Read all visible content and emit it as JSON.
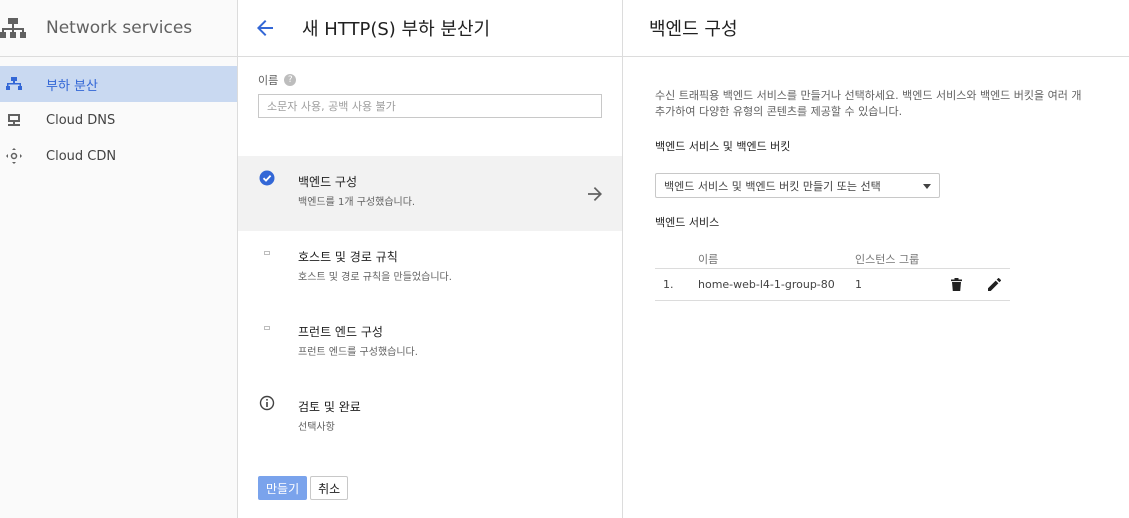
{
  "nav": {
    "title": "Network services",
    "items": [
      {
        "label": "부하 분산",
        "icon": "load-balancing-icon",
        "active": true
      },
      {
        "label": "Cloud DNS",
        "icon": "dns-icon",
        "active": false
      },
      {
        "label": "Cloud CDN",
        "icon": "cdn-icon",
        "active": false
      }
    ]
  },
  "middle": {
    "title": "새 HTTP(S) 부하 분산기",
    "name_label": "이름",
    "name_placeholder": "소문자 사용, 공백 사용 불가",
    "steps": [
      {
        "title": "백엔드 구성",
        "subtitle": "백엔드를 1개 구성했습니다.",
        "icon": "check-circle-icon",
        "active": true
      },
      {
        "title": "호스트 및 경로 규칙",
        "subtitle": "호스트 및 경로 규칙을 만들었습니다.",
        "icon": "pending-dot-icon",
        "active": false
      },
      {
        "title": "프런트 엔드 구성",
        "subtitle": "프런트 엔드를 구성했습니다.",
        "icon": "pending-dot-icon",
        "active": false
      },
      {
        "title": "검토 및 완료",
        "subtitle": "선택사항",
        "icon": "info-icon",
        "active": false
      }
    ],
    "create_label": "만들기",
    "cancel_label": "취소"
  },
  "right": {
    "title": "백엔드 구성",
    "description": "수신 트래픽용 백엔드 서비스를 만들거나 선택하세요. 백엔드 서비스와 백엔드 버킷을 여러 개 추가하여 다양한 유형의 콘텐츠를 제공할 수 있습니다.",
    "services_buckets_label": "백엔드 서비스 및 백엔드 버킷",
    "select_value": "백엔드 서비스 및 백엔드 버킷 만들기 또는 선택",
    "services_label": "백엔드 서비스",
    "table": {
      "headers": [
        "이름",
        "인스턴스 그룹"
      ],
      "rows": [
        {
          "index": "1.",
          "name": "home-web-l4-1-group-80",
          "groups": "1"
        }
      ]
    }
  },
  "colors": {
    "accent": "#3367d6",
    "active_nav_bg": "#c9d9f1",
    "primary_button": "#7aa3ec"
  }
}
